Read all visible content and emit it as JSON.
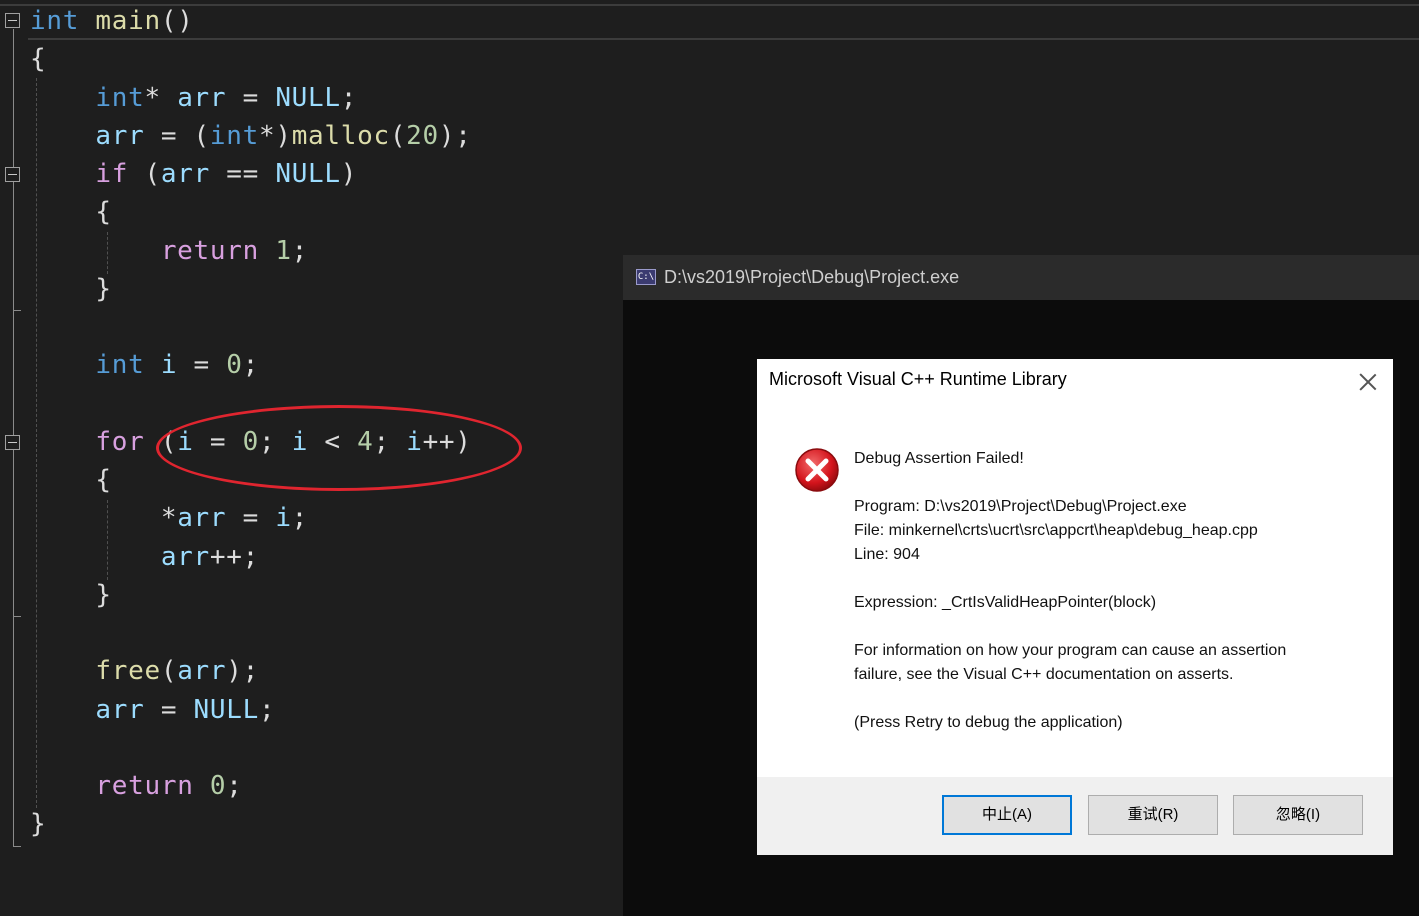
{
  "editor": {
    "lines": [
      [
        {
          "t": "int",
          "c": "kw"
        },
        {
          "t": " "
        },
        {
          "t": "main",
          "c": "fn"
        },
        {
          "t": "()"
        }
      ],
      [
        {
          "t": "{"
        }
      ],
      [
        {
          "t": "    "
        },
        {
          "t": "int",
          "c": "kw"
        },
        {
          "t": "* "
        },
        {
          "t": "arr",
          "c": "var"
        },
        {
          "t": " = "
        },
        {
          "t": "NULL",
          "c": "var"
        },
        {
          "t": ";"
        }
      ],
      [
        {
          "t": "    "
        },
        {
          "t": "arr",
          "c": "var"
        },
        {
          "t": " = ("
        },
        {
          "t": "int",
          "c": "kw"
        },
        {
          "t": "*)"
        },
        {
          "t": "malloc",
          "c": "fn"
        },
        {
          "t": "("
        },
        {
          "t": "20",
          "c": "num"
        },
        {
          "t": ");"
        }
      ],
      [
        {
          "t": "    "
        },
        {
          "t": "if",
          "c": "ctl"
        },
        {
          "t": " ("
        },
        {
          "t": "arr",
          "c": "var"
        },
        {
          "t": " == "
        },
        {
          "t": "NULL",
          "c": "var"
        },
        {
          "t": ")"
        }
      ],
      [
        {
          "t": "    {"
        }
      ],
      [
        {
          "t": "        "
        },
        {
          "t": "return",
          "c": "ctl"
        },
        {
          "t": " "
        },
        {
          "t": "1",
          "c": "num"
        },
        {
          "t": ";"
        }
      ],
      [
        {
          "t": "    }"
        }
      ],
      [
        {
          "t": ""
        }
      ],
      [
        {
          "t": "    "
        },
        {
          "t": "int",
          "c": "kw"
        },
        {
          "t": " "
        },
        {
          "t": "i",
          "c": "var"
        },
        {
          "t": " = "
        },
        {
          "t": "0",
          "c": "num"
        },
        {
          "t": ";"
        }
      ],
      [
        {
          "t": ""
        }
      ],
      [
        {
          "t": "    "
        },
        {
          "t": "for",
          "c": "ctl"
        },
        {
          "t": " ("
        },
        {
          "t": "i",
          "c": "var"
        },
        {
          "t": " = "
        },
        {
          "t": "0",
          "c": "num"
        },
        {
          "t": "; "
        },
        {
          "t": "i",
          "c": "var"
        },
        {
          "t": " < "
        },
        {
          "t": "4",
          "c": "num"
        },
        {
          "t": "; "
        },
        {
          "t": "i",
          "c": "var"
        },
        {
          "t": "++)"
        }
      ],
      [
        {
          "t": "    {"
        }
      ],
      [
        {
          "t": "        *"
        },
        {
          "t": "arr",
          "c": "var"
        },
        {
          "t": " = "
        },
        {
          "t": "i",
          "c": "var"
        },
        {
          "t": ";"
        }
      ],
      [
        {
          "t": "        "
        },
        {
          "t": "arr",
          "c": "var"
        },
        {
          "t": "++;"
        }
      ],
      [
        {
          "t": "    }"
        }
      ],
      [
        {
          "t": ""
        }
      ],
      [
        {
          "t": "    "
        },
        {
          "t": "free",
          "c": "fn"
        },
        {
          "t": "("
        },
        {
          "t": "arr",
          "c": "var"
        },
        {
          "t": ");"
        }
      ],
      [
        {
          "t": "    "
        },
        {
          "t": "arr",
          "c": "var"
        },
        {
          "t": " = "
        },
        {
          "t": "NULL",
          "c": "var"
        },
        {
          "t": ";"
        }
      ],
      [
        {
          "t": ""
        }
      ],
      [
        {
          "t": "    "
        },
        {
          "t": "return",
          "c": "ctl"
        },
        {
          "t": " "
        },
        {
          "t": "0",
          "c": "num"
        },
        {
          "t": ";"
        }
      ],
      [
        {
          "t": "}"
        }
      ]
    ],
    "colors": {
      "background": "#1e1e1e",
      "keyword": "#569cd6",
      "control": "#d8a0df",
      "function": "#dcdcaa",
      "variable": "#9cdcfe",
      "number": "#b5cea8",
      "annotation": "#e0252f"
    }
  },
  "console": {
    "title": "D:\\vs2019\\Project\\Debug\\Project.exe",
    "icon": "C:\\"
  },
  "dialog": {
    "title": "Microsoft Visual C++ Runtime Library",
    "heading": "Debug Assertion Failed!",
    "program": "Program: D:\\vs2019\\Project\\Debug\\Project.exe",
    "file": "File: minkernel\\crts\\ucrt\\src\\appcrt\\heap\\debug_heap.cpp",
    "line": "Line: 904",
    "expression": "Expression: _CrtIsValidHeapPointer(block)",
    "info1": "For information on how your program can cause an assertion",
    "info2": "failure, see the Visual C++ documentation on asserts.",
    "press": "(Press Retry to debug the application)",
    "buttons": {
      "abort": "中止(A)",
      "retry": "重试(R)",
      "ignore": "忽略(I)"
    }
  }
}
